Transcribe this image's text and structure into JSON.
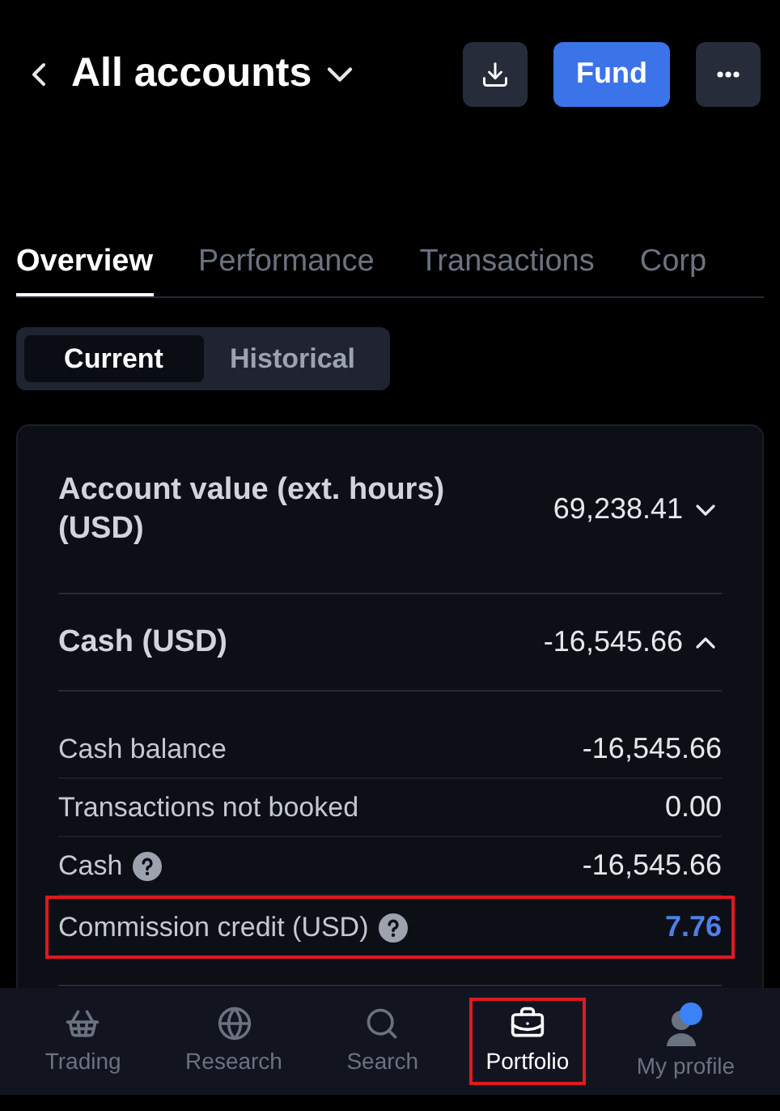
{
  "header": {
    "title": "All accounts",
    "fund_button": "Fund"
  },
  "tabs": [
    {
      "label": "Overview",
      "selected": true
    },
    {
      "label": "Performance",
      "selected": false
    },
    {
      "label": "Transactions",
      "selected": false
    },
    {
      "label": "Corp",
      "selected": false
    }
  ],
  "segments": [
    {
      "label": "Current",
      "selected": true
    },
    {
      "label": "Historical",
      "selected": false
    }
  ],
  "summary": [
    {
      "label": "Account value (ext. hours) (USD)",
      "value": "69,238.41",
      "expanded": false
    },
    {
      "label": "Cash (USD)",
      "value": "-16,545.66",
      "expanded": true
    }
  ],
  "cash_rows": [
    {
      "label": "Cash balance",
      "value": "-16,545.66",
      "help": false,
      "highlighted": false
    },
    {
      "label": "Transactions not booked",
      "value": "0.00",
      "help": false,
      "highlighted": false
    },
    {
      "label": "Cash",
      "value": "-16,545.66",
      "help": true,
      "highlighted": false
    },
    {
      "label": "Commission credit (USD)",
      "value": "7.76",
      "help": true,
      "highlighted": true
    }
  ],
  "nav": [
    {
      "kind": "trading",
      "label": "Trading",
      "selected": false,
      "highlighted": false
    },
    {
      "kind": "research",
      "label": "Research",
      "selected": false,
      "highlighted": false
    },
    {
      "kind": "search",
      "label": "Search",
      "selected": false,
      "highlighted": false
    },
    {
      "kind": "portfolio",
      "label": "Portfolio",
      "selected": true,
      "highlighted": true
    },
    {
      "kind": "profile",
      "label": "My profile",
      "selected": false,
      "highlighted": false
    }
  ]
}
